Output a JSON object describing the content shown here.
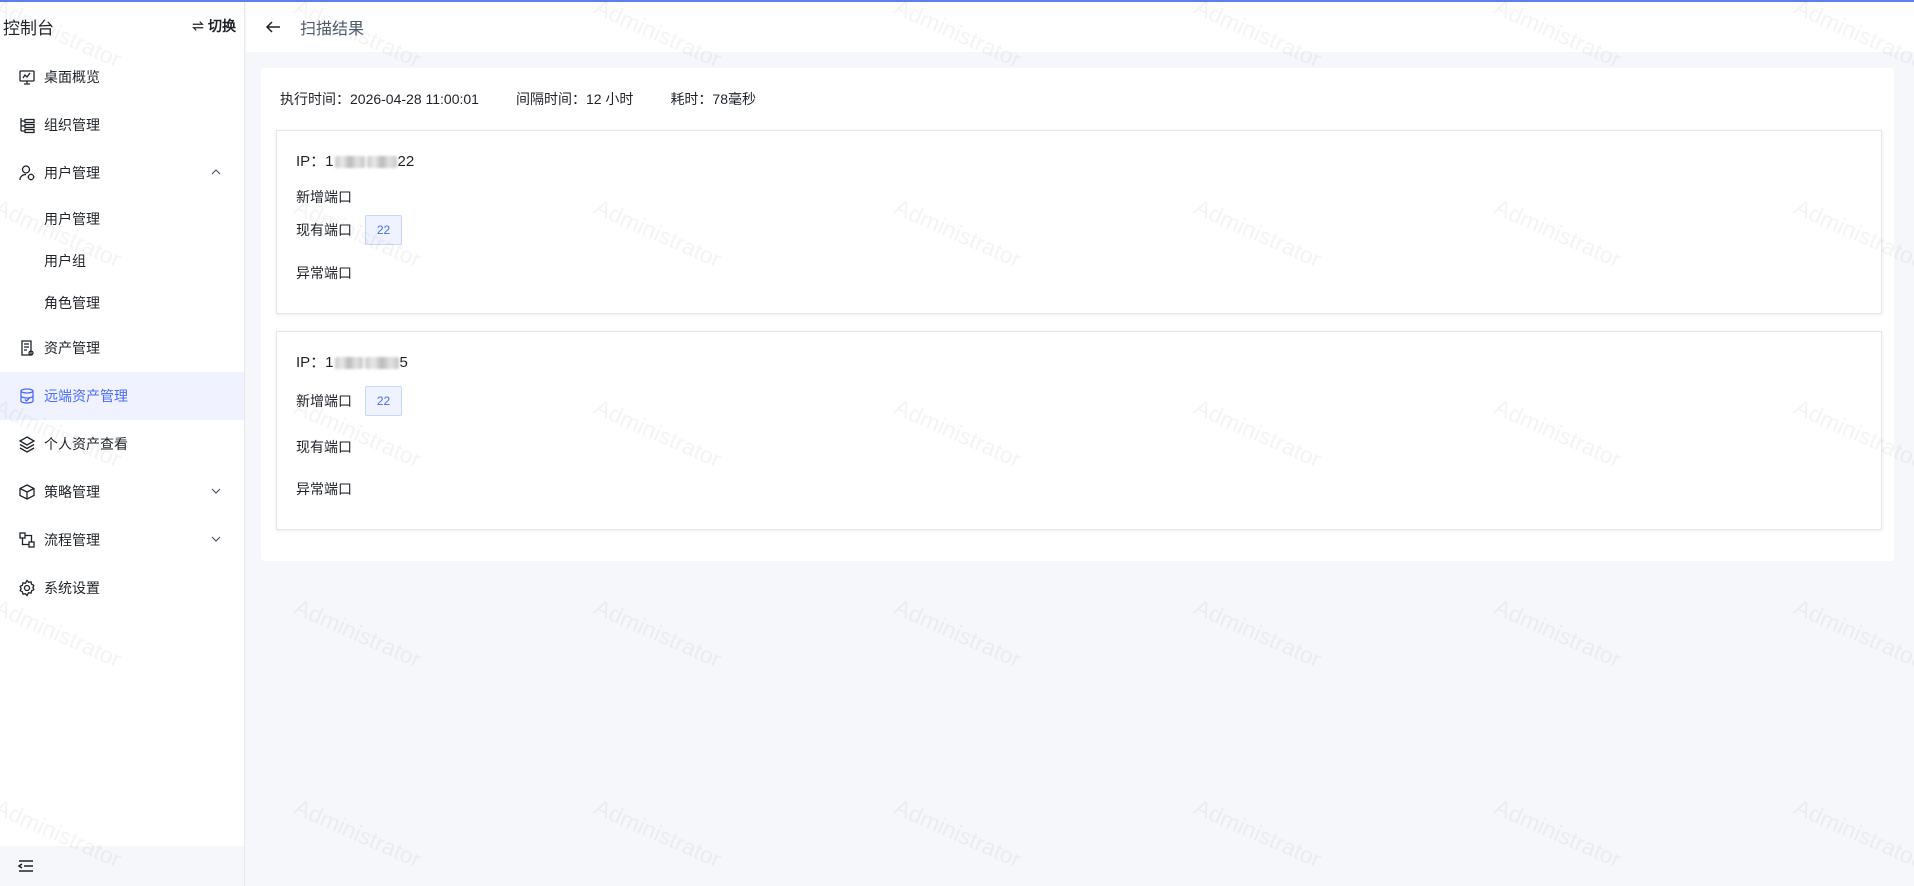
{
  "sidebar": {
    "title": "控制台",
    "switch_label": "切换",
    "items": [
      {
        "label": "桌面概览",
        "icon": "monitor-icon"
      },
      {
        "label": "组织管理",
        "icon": "org-tree-icon"
      },
      {
        "label": "用户管理",
        "icon": "user-settings-icon",
        "expanded": true
      },
      {
        "label": "资产管理",
        "icon": "asset-doc-icon"
      },
      {
        "label": "远端资产管理",
        "icon": "database-icon",
        "active": true
      },
      {
        "label": "个人资产查看",
        "icon": "layers-icon"
      },
      {
        "label": "策略管理",
        "icon": "cube-icon"
      },
      {
        "label": "流程管理",
        "icon": "flow-icon"
      },
      {
        "label": "系统设置",
        "icon": "gear-icon"
      }
    ],
    "sub_items": [
      "用户管理",
      "用户组",
      "角色管理"
    ]
  },
  "header": {
    "title": "扫描结果"
  },
  "summary": {
    "exec_time": "执行时间：2026-04-28 11:00:01",
    "interval": "间隔时间：12 小时",
    "duration": "耗时：78毫秒"
  },
  "cards": [
    {
      "ip_prefix": "IP：1",
      "ip_suffix": "22",
      "new_ports_label": "新增端口",
      "existing_ports_label": "现有端口",
      "abnormal_ports_label": "异常端口",
      "existing_ports": [
        "22"
      ]
    },
    {
      "ip_prefix": "IP：1",
      "ip_suffix": "5",
      "new_ports_label": "新增端口",
      "existing_ports_label": "现有端口",
      "abnormal_ports_label": "异常端口",
      "new_ports": [
        "22"
      ]
    }
  ],
  "watermark": "Administrator",
  "colors": {
    "accent": "#4a6cf7",
    "active_bg": "#f0f3ff",
    "tag_bg": "#eef3ff",
    "page_bg": "#f6f7fb"
  }
}
